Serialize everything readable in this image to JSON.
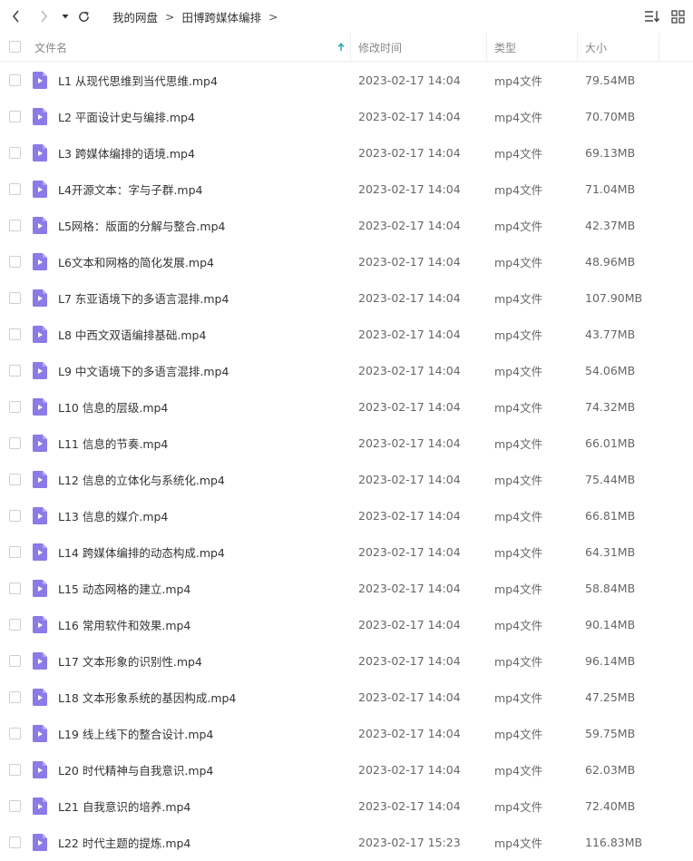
{
  "breadcrumb": [
    "我的网盘",
    "田博跨媒体编排"
  ],
  "columns": {
    "name": "文件名",
    "modified": "修改时间",
    "type": "类型",
    "size": "大小"
  },
  "colors": {
    "icon_purple": "#8c7ae6",
    "sort_arrow": "#19a6b5"
  },
  "files": [
    {
      "name": "L1 从现代思维到当代思维.mp4",
      "modified": "2023-02-17 14:04",
      "type": "mp4文件",
      "size": "79.54MB"
    },
    {
      "name": "L2 平面设计史与编排.mp4",
      "modified": "2023-02-17 14:04",
      "type": "mp4文件",
      "size": "70.70MB"
    },
    {
      "name": "L3 跨媒体编排的语境.mp4",
      "modified": "2023-02-17 14:04",
      "type": "mp4文件",
      "size": "69.13MB"
    },
    {
      "name": "L4开源文本：字与子群.mp4",
      "modified": "2023-02-17 14:04",
      "type": "mp4文件",
      "size": "71.04MB"
    },
    {
      "name": "L5网格：版面的分解与整合.mp4",
      "modified": "2023-02-17 14:04",
      "type": "mp4文件",
      "size": "42.37MB"
    },
    {
      "name": "L6文本和网格的简化发展.mp4",
      "modified": "2023-02-17 14:04",
      "type": "mp4文件",
      "size": "48.96MB"
    },
    {
      "name": "L7 东亚语境下的多语言混排.mp4",
      "modified": "2023-02-17 14:04",
      "type": "mp4文件",
      "size": "107.90MB"
    },
    {
      "name": "L8 中西文双语编排基础.mp4",
      "modified": "2023-02-17 14:04",
      "type": "mp4文件",
      "size": "43.77MB"
    },
    {
      "name": "L9 中文语境下的多语言混排.mp4",
      "modified": "2023-02-17 14:04",
      "type": "mp4文件",
      "size": "54.06MB"
    },
    {
      "name": "L10 信息的层级.mp4",
      "modified": "2023-02-17 14:04",
      "type": "mp4文件",
      "size": "74.32MB"
    },
    {
      "name": "L11 信息的节奏.mp4",
      "modified": "2023-02-17 14:04",
      "type": "mp4文件",
      "size": "66.01MB"
    },
    {
      "name": "L12 信息的立体化与系统化.mp4",
      "modified": "2023-02-17 14:04",
      "type": "mp4文件",
      "size": "75.44MB"
    },
    {
      "name": "L13 信息的媒介.mp4",
      "modified": "2023-02-17 14:04",
      "type": "mp4文件",
      "size": "66.81MB"
    },
    {
      "name": "L14 跨媒体编排的动态构成.mp4",
      "modified": "2023-02-17 14:04",
      "type": "mp4文件",
      "size": "64.31MB"
    },
    {
      "name": "L15 动态网格的建立.mp4",
      "modified": "2023-02-17 14:04",
      "type": "mp4文件",
      "size": "58.84MB"
    },
    {
      "name": "L16 常用软件和效果.mp4",
      "modified": "2023-02-17 14:04",
      "type": "mp4文件",
      "size": "90.14MB"
    },
    {
      "name": "L17 文本形象的识别性.mp4",
      "modified": "2023-02-17 14:04",
      "type": "mp4文件",
      "size": "96.14MB"
    },
    {
      "name": "L18 文本形象系统的基因构成.mp4",
      "modified": "2023-02-17 14:04",
      "type": "mp4文件",
      "size": "47.25MB"
    },
    {
      "name": "L19 线上线下的整合设计.mp4",
      "modified": "2023-02-17 14:04",
      "type": "mp4文件",
      "size": "59.75MB"
    },
    {
      "name": "L20 时代精神与自我意识.mp4",
      "modified": "2023-02-17 14:04",
      "type": "mp4文件",
      "size": "62.03MB"
    },
    {
      "name": "L21 自我意识的培养.mp4",
      "modified": "2023-02-17 14:04",
      "type": "mp4文件",
      "size": "72.40MB"
    },
    {
      "name": "L22 时代主题的提炼.mp4",
      "modified": "2023-02-17 15:23",
      "type": "mp4文件",
      "size": "116.83MB"
    }
  ]
}
